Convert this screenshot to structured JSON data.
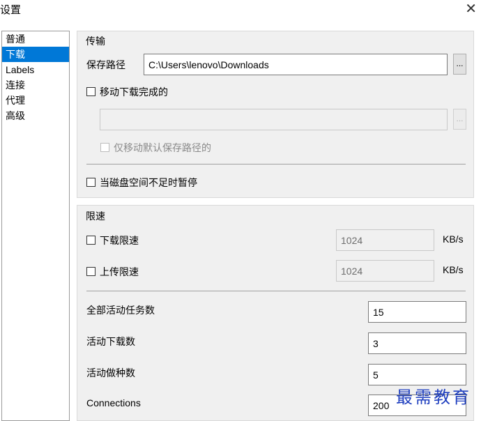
{
  "window": {
    "title": "设置",
    "close_glyph": "✕"
  },
  "sidebar": {
    "items": [
      {
        "label": "普通",
        "selected": false
      },
      {
        "label": "下载",
        "selected": true
      },
      {
        "label": "Labels",
        "selected": false
      },
      {
        "label": "连接",
        "selected": false
      },
      {
        "label": "代理",
        "selected": false
      },
      {
        "label": "高级",
        "selected": false
      }
    ]
  },
  "transfer": {
    "title": "传输",
    "save_path_label": "保存路径",
    "save_path_value": "C:\\Users\\lenovo\\Downloads",
    "browse_label": "...",
    "move_completed_label": "移动下载完成的",
    "move_completed_checked": false,
    "move_path_value": "",
    "move_browse_label": "...",
    "only_default_label": "仅移动默认保存路径的",
    "pause_low_disk_label": "当磁盘空间不足时暂停"
  },
  "rate_limit": {
    "title": "限速",
    "download_label": "下载限速",
    "download_value": "1024",
    "download_unit": "KB/s",
    "upload_label": "上传限速",
    "upload_value": "1024",
    "upload_unit": "KB/s",
    "total_active_label": "全部活动任务数",
    "total_active_value": "15",
    "active_downloads_label": "活动下载数",
    "active_downloads_value": "3",
    "active_seeds_label": "活动做种数",
    "active_seeds_value": "5",
    "connections_label": "Connections",
    "connections_value": "200"
  },
  "watermark": {
    "text": "最需教育"
  }
}
